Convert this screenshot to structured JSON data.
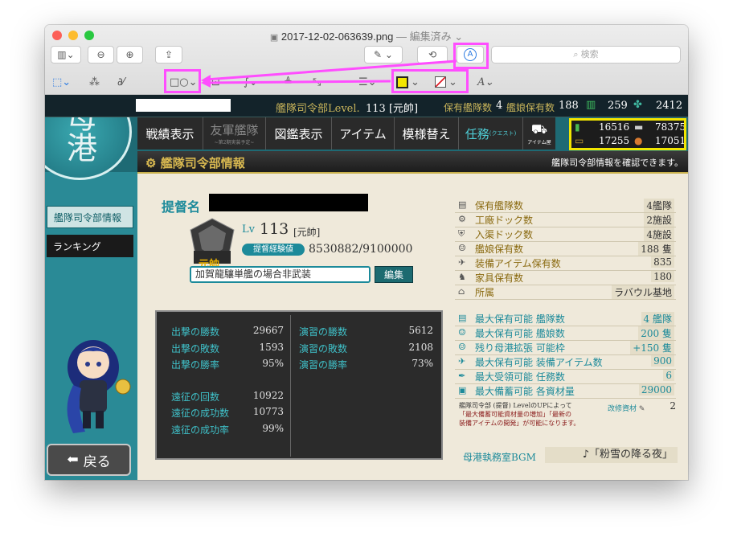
{
  "window": {
    "title": "2017-12-02-063639.png",
    "subtitle": "— 編集済み ⌄",
    "search_placeholder": "検索"
  },
  "game": {
    "top": {
      "command_level_label": "艦隊司令部Level.",
      "level": "113",
      "rank_tag": "[元帥]",
      "ships_label": "保有艦隊数",
      "ships_value": "4",
      "girls_label": "艦娘保有数",
      "girls_value": "188",
      "bucket_value": "259",
      "devmat_value": "2412"
    },
    "tabs": [
      {
        "label": "戦績表示"
      },
      {
        "label": "友軍艦隊",
        "sub": "~第2期実装予定~"
      },
      {
        "label": "図鑑表示"
      },
      {
        "label": "アイテム"
      },
      {
        "label": "模様替え"
      },
      {
        "label": "任務",
        "sub": "(クエスト)"
      },
      {
        "label": "アイテム屋"
      }
    ],
    "resources": {
      "fuel": "16516",
      "steel": "78375",
      "ammo": "17255",
      "bauxite": "17051"
    },
    "header": {
      "title": "艦隊司令部情報",
      "hint": "艦隊司令部情報を確認できます。"
    },
    "side": {
      "info": "艦隊司令部情報",
      "ranking": "ランキング",
      "back": "戻る"
    },
    "profile": {
      "name_label": "提督名",
      "lv_label": "Lv",
      "lv_value": "113",
      "rank": "[元帥]",
      "rank_badge": "元帥",
      "exp_label": "提督経験値",
      "exp_value": "8530882/9100000",
      "comment": "加賀龍驤単艦の場合非武装",
      "edit_label": "編集"
    },
    "battle": {
      "sortie_wins_label": "出撃の勝数",
      "sortie_wins": "29667",
      "sortie_losses_label": "出撃の敗数",
      "sortie_losses": "1593",
      "sortie_rate_label": "出撃の勝率",
      "sortie_rate": "95%",
      "exercise_wins_label": "演習の勝数",
      "exercise_wins": "5612",
      "exercise_losses_label": "演習の敗数",
      "exercise_losses": "2108",
      "exercise_rate_label": "演習の勝率",
      "exercise_rate": "73%",
      "expedition_count_label": "遠征の回数",
      "expedition_count": "10922",
      "expedition_success_label": "遠征の成功数",
      "expedition_success": "10773",
      "expedition_rate_label": "遠征の成功率",
      "expedition_rate": "99%"
    },
    "info": [
      {
        "label": "保有艦隊数",
        "value": "4艦隊"
      },
      {
        "label": "工廠ドック数",
        "value": "2施設"
      },
      {
        "label": "入渠ドック数",
        "value": "4施設"
      },
      {
        "label": "艦娘保有数",
        "value": "188 隻"
      },
      {
        "label": "装備アイテム保有数",
        "value": "835"
      },
      {
        "label": "家具保有数",
        "value": "180"
      },
      {
        "label": "所属",
        "value": "ラバウル基地"
      }
    ],
    "limits": [
      {
        "label": "最大保有可能 艦隊数",
        "value": "4 艦隊"
      },
      {
        "label": "最大保有可能 艦娘数",
        "value": "200 隻"
      },
      {
        "label": "残り母港拡張 可能枠",
        "value": "+150 隻"
      },
      {
        "label": "最大保有可能 装備アイテム数",
        "value": "900"
      },
      {
        "label": "最大受領可能 任務数",
        "value": "6"
      },
      {
        "label": "最大備蓄可能 各資材量",
        "value": "29000"
      }
    ],
    "note": {
      "line1": "艦隊司令部 (提督) LevelのUPによって",
      "line2": "「最大備蓄可能資材量の増加」「最新の",
      "line3": "装備アイテムの開発」が可能になります。",
      "kaishu_label": "改修資材",
      "kaishu_value": "2"
    },
    "bgm": {
      "label": "母港執務室BGM",
      "value": "♪「粉雪の降る夜」"
    },
    "port_logo": "母港"
  },
  "colors": {
    "annotation": "#ff4dff",
    "highlight": "#f2e600"
  }
}
